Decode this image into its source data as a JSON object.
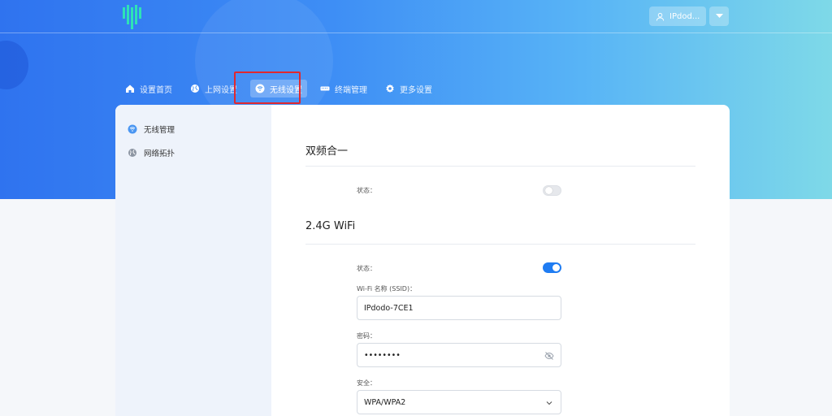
{
  "header": {
    "user_label": "IPdod...",
    "user_icon": "user-icon",
    "dropdown_icon": "caret-down-icon"
  },
  "nav": {
    "items": [
      {
        "label": "设置首页",
        "icon": "home-icon"
      },
      {
        "label": "上网设置",
        "icon": "globe-icon"
      },
      {
        "label": "无线设置",
        "icon": "wifi-icon",
        "active": true
      },
      {
        "label": "终端管理",
        "icon": "keyboard-icon"
      },
      {
        "label": "更多设置",
        "icon": "gear-icon"
      }
    ]
  },
  "sidebar": {
    "items": [
      {
        "label": "无线管理",
        "icon": "wifi-icon"
      },
      {
        "label": "网络拓扑",
        "icon": "globe-icon"
      }
    ]
  },
  "content": {
    "dual_band": {
      "title": "双频合一",
      "status_label": "状态：",
      "status_on": false
    },
    "wifi24": {
      "title": "2.4G WiFi",
      "status_label": "状态：",
      "status_on": true,
      "ssid_label": "Wi-Fi 名称 (SSID)：",
      "ssid_value": "IPdodo-7CE1",
      "password_label": "密码：",
      "password_value": "••••••••",
      "security_label": "安全：",
      "security_value": "WPA/WPA2"
    }
  },
  "colors": {
    "accent": "#1f7cf2",
    "highlight_box": "#e0282f",
    "logo": "#2ee3b6"
  }
}
